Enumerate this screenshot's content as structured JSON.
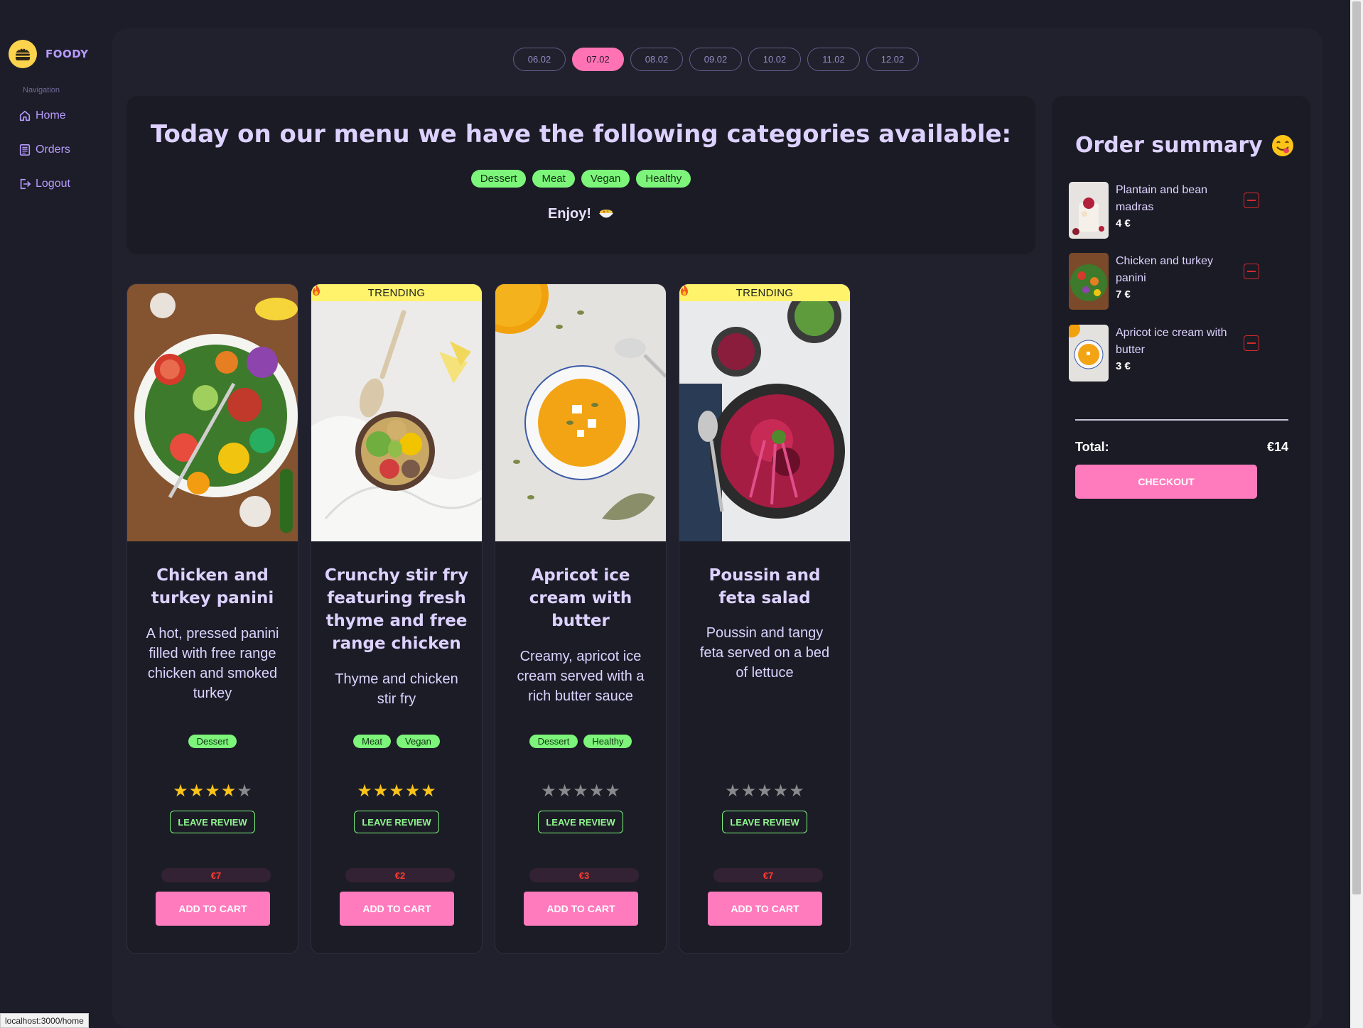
{
  "app": {
    "name": "FOODY",
    "logo_icon": "burger-icon"
  },
  "sidebar": {
    "heading": "Navigation",
    "items": [
      {
        "label": "Home",
        "icon": "home-icon"
      },
      {
        "label": "Orders",
        "icon": "orders-icon"
      },
      {
        "label": "Logout",
        "icon": "logout-icon"
      }
    ]
  },
  "dates": {
    "items": [
      "06.02",
      "07.02",
      "08.02",
      "09.02",
      "10.02",
      "11.02",
      "12.02"
    ],
    "selected": "07.02"
  },
  "hero": {
    "title": "Today on our menu we have the following categories available:",
    "categories": [
      "Dessert",
      "Meat",
      "Vegan",
      "Healthy"
    ],
    "enjoy": "Enjoy!",
    "enjoy_icon": "bowl-emoji"
  },
  "cards": [
    {
      "title": "Chicken and turkey panini",
      "description": "A hot, pressed panini filled with free range chicken and smoked turkey",
      "tags": [
        "Dessert"
      ],
      "rating": 4,
      "max_rating": 5,
      "price": "€7",
      "trending": false,
      "review_label": "LEAVE REVIEW",
      "cart_label": "ADD TO CART"
    },
    {
      "title": "Crunchy stir fry featuring fresh thyme and free range chicken",
      "description": "Thyme and chicken stir fry",
      "tags": [
        "Meat",
        "Vegan"
      ],
      "rating": 5,
      "max_rating": 5,
      "price": "€2",
      "trending": true,
      "trending_label": "TRENDING",
      "review_label": "LEAVE REVIEW",
      "cart_label": "ADD TO CART"
    },
    {
      "title": "Apricot ice cream with butter",
      "description": "Creamy, apricot ice cream served with a rich butter sauce",
      "tags": [
        "Dessert",
        "Healthy"
      ],
      "rating": 0,
      "max_rating": 5,
      "price": "€3",
      "trending": false,
      "review_label": "LEAVE REVIEW",
      "cart_label": "ADD TO CART"
    },
    {
      "title": "Poussin and feta salad",
      "description": "Poussin and tangy feta served on a bed of lettuce",
      "tags": [],
      "rating": 0,
      "max_rating": 5,
      "price": "€7",
      "trending": true,
      "trending_label": "TRENDING",
      "review_label": "LEAVE REVIEW",
      "cart_label": "ADD TO CART"
    }
  ],
  "summary": {
    "title": "Order summary",
    "title_icon": "yum-emoji",
    "items": [
      {
        "name": "Plantain and bean madras",
        "price": "4 €"
      },
      {
        "name": "Chicken and turkey panini",
        "price": "7 €"
      },
      {
        "name": "Apricot ice cream with butter",
        "price": "3 €"
      }
    ],
    "total_label": "Total:",
    "total_value": "€14",
    "checkout_label": "CHECKOUT"
  },
  "status_url": "localhost:3000/home",
  "colors": {
    "accent": "#ff7bbd",
    "tag": "#7cf57a",
    "title": "#ddd2ff",
    "bg": "#1d1d29",
    "panel": "#21212d",
    "trending": "#fef36b"
  }
}
